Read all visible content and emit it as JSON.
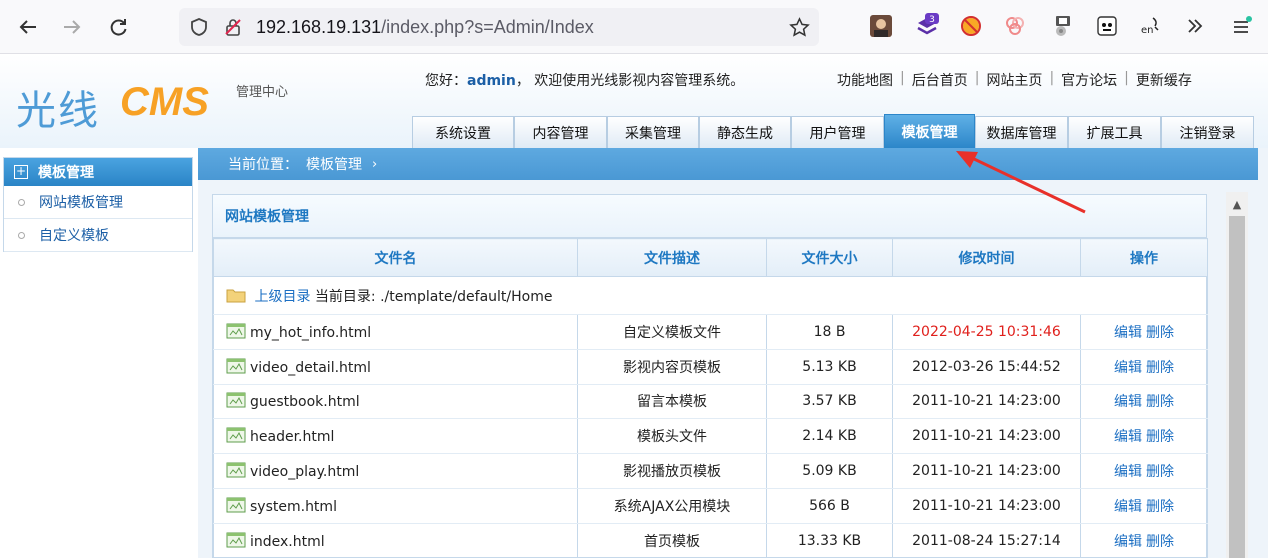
{
  "browser": {
    "url_host": "192.168.19.131",
    "url_path": "/index.php?s=Admin/Index",
    "extension_badge": "3"
  },
  "header": {
    "logo_cn": "光线",
    "logo_cms": "CMS",
    "logo_sub": "管理中心",
    "welcome_prefix": "您好：",
    "username": "admin",
    "welcome_suffix": "， 欢迎使用光线影视内容管理系统。",
    "top_links": [
      "功能地图",
      "后台首页",
      "网站主页",
      "官方论坛",
      "更新缓存"
    ]
  },
  "tabs": [
    {
      "label": "系统设置",
      "active": false
    },
    {
      "label": "内容管理",
      "active": false
    },
    {
      "label": "采集管理",
      "active": false
    },
    {
      "label": "静态生成",
      "active": false
    },
    {
      "label": "用户管理",
      "active": false
    },
    {
      "label": "模板管理",
      "active": true
    },
    {
      "label": "数据库管理",
      "active": false
    },
    {
      "label": "扩展工具",
      "active": false
    },
    {
      "label": "注销登录",
      "active": false
    }
  ],
  "sidebar": {
    "title": "模板管理",
    "items": [
      {
        "label": "网站模板管理"
      },
      {
        "label": "自定义模板"
      }
    ]
  },
  "breadcrumb": {
    "prefix": "当前位置：",
    "current": "模板管理"
  },
  "panel": {
    "title": "网站模板管理",
    "columns": [
      "文件名",
      "文件描述",
      "文件大小",
      "修改时间",
      "操作"
    ],
    "parent_dir_label": "上级目录",
    "current_dir_label": "当前目录: ./template/default/Home",
    "edit_label": "编辑",
    "delete_label": "删除",
    "files": [
      {
        "name": "my_hot_info.html",
        "desc": "自定义模板文件",
        "size": "18 B",
        "mtime": "2022-04-25 10:31:46",
        "highlight": true
      },
      {
        "name": "video_detail.html",
        "desc": "影视内容页模板",
        "size": "5.13 KB",
        "mtime": "2012-03-26 15:44:52",
        "highlight": false
      },
      {
        "name": "guestbook.html",
        "desc": "留言本模板",
        "size": "3.57 KB",
        "mtime": "2011-10-21 14:23:00",
        "highlight": false
      },
      {
        "name": "header.html",
        "desc": "模板头文件",
        "size": "2.14 KB",
        "mtime": "2011-10-21 14:23:00",
        "highlight": false
      },
      {
        "name": "video_play.html",
        "desc": "影视播放页模板",
        "size": "5.09 KB",
        "mtime": "2011-10-21 14:23:00",
        "highlight": false
      },
      {
        "name": "system.html",
        "desc": "系统AJAX公用模块",
        "size": "566 B",
        "mtime": "2011-10-21 14:23:00",
        "highlight": false
      },
      {
        "name": "index.html",
        "desc": "首页模板",
        "size": "13.33 KB",
        "mtime": "2011-08-24 15:27:14",
        "highlight": false
      }
    ]
  },
  "colors": {
    "accent_blue": "#2c86c9",
    "link_blue": "#1c6fc3",
    "highlight_red": "#e0201c",
    "annotation_arrow": "#e8302a"
  }
}
